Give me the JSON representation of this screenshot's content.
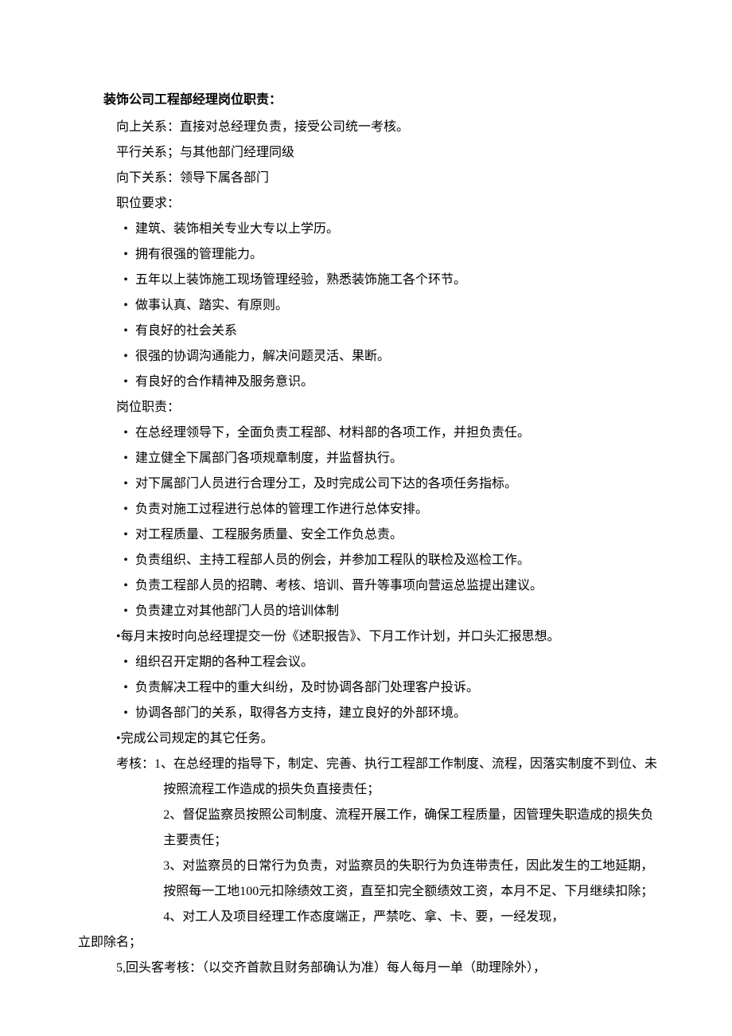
{
  "title": "装饰公司工程部经理岗位职责：",
  "relations": {
    "up": "向上关系：直接对总经理负责，接受公司统一考核。",
    "peer": "平行关系；与其他部门经理同级",
    "down": "向下关系：领导下属各部门"
  },
  "requirements_head": "职位要求：",
  "requirements": [
    "建筑、装饰相关专业大专以上学历。",
    "拥有很强的管理能力。",
    "五年以上装饰施工现场管理经验，熟悉装饰施工各个环节。",
    "做事认真、踏实、有原则。",
    "有良好的社会关系",
    "很强的协调沟通能力，解决问题灵活、果断。",
    "有良好的合作精神及服务意识。"
  ],
  "duties_head": "岗位职责：",
  "duties_a": [
    "在总经理领导下，全面负责工程部、材料部的各项工作，并担负责任。",
    "建立健全下属部门各项规章制度，并监督执行。",
    "对下属部门人员进行合理分工，及时完成公司下达的各项任务指标。",
    "负责对施工过程进行总体的管理工作进行总体安排。",
    "对工程质量、工程服务质量、安全工作负总责。",
    "负责组织、主持工程部人员的例会，并参加工程队的联检及巡检工作。",
    "负责工程部人员的招聘、考核、培训、晋升等事项向营运总监提出建议。",
    "负责建立对其他部门人员的培训体制"
  ],
  "duty_special1": "每月末按时向总经理提交一份《述职报告》、下月工作计划，并口头汇报思想。",
  "duties_b": [
    "组织召开定期的各种工程会议。",
    "负责解决工程中的重大纠纷，及时协调各部门处理客户投诉。",
    "协调各部门的关系，取得各方支持，建立良好的外部环境。"
  ],
  "duty_special2": "完成公司规定的其它任务。",
  "kaohe_label": "考核：",
  "kaohe_items": [
    {
      "num": "1、",
      "text": "在总经理的指导下，制定、完善、执行工程部工作制度、流程，因落实制度不到位、未按照流程工作造成的损失负直接责任；"
    },
    {
      "num": "2、",
      "text": "督促监察员按照公司制度、流程开展工作，确保工程质量，因管理失职造成的损失负主要责任；"
    },
    {
      "num": "3、",
      "text": "对监察员的日常行为负责，对监察员的失职行为负连带责任，因此发生的工地延期，按照每一工地100元扣除绩效工资，直至扣完全额绩效工资，本月不足、下月继续扣除；"
    },
    {
      "num": "4、",
      "text": "对工人及项目经理工作态度端正，严禁吃、拿、卡、要，一经发现，"
    }
  ],
  "kaohe4_tail": "立即除名；",
  "kaohe5": {
    "num": "5,",
    "text": "回头客考核：（以交齐首款且财务部确认为准）每人每月一单（助理除外），"
  }
}
